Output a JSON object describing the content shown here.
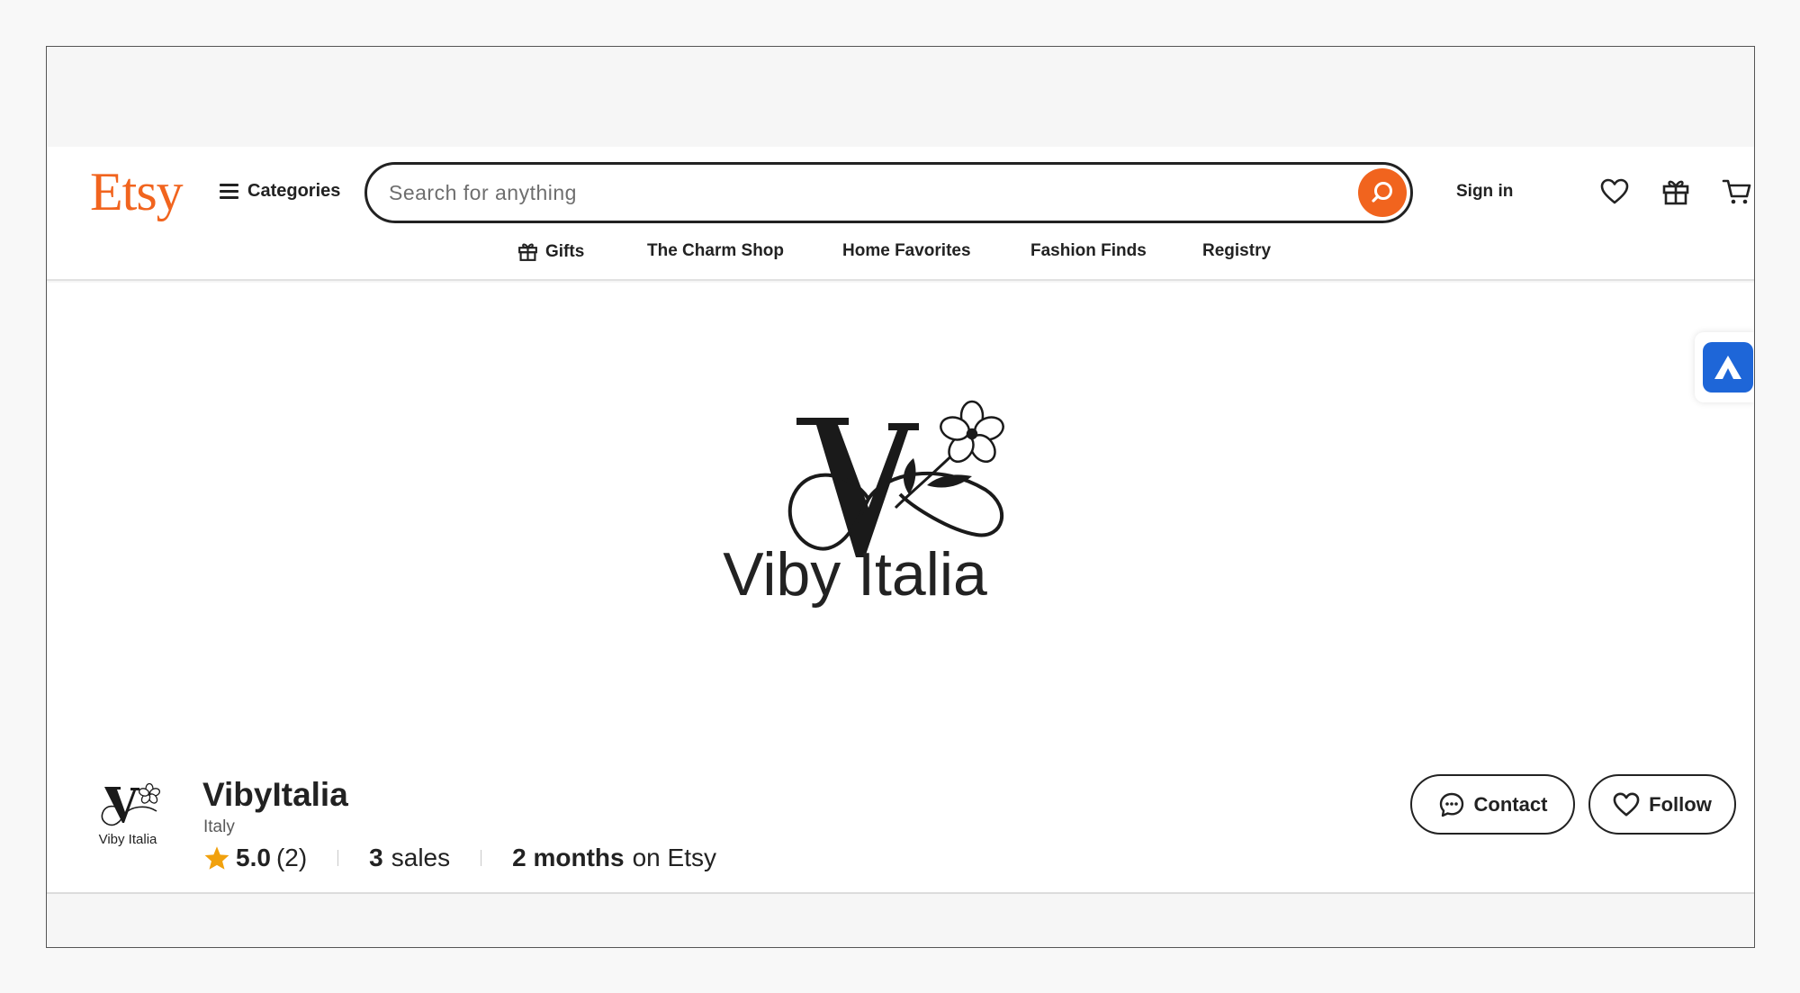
{
  "header": {
    "logo": "Etsy",
    "categories_label": "Categories",
    "search_placeholder": "Search for anything",
    "sign_in": "Sign in"
  },
  "nav": {
    "items": [
      "Gifts",
      "The Charm Shop",
      "Home Favorites",
      "Fashion Finds",
      "Registry"
    ]
  },
  "banner": {
    "logo_text": "Viby Italia"
  },
  "shop": {
    "avatar_text": "Viby Italia",
    "name": "VibyItalia",
    "location": "Italy",
    "rating": "5.0",
    "review_count": "(2)",
    "sales_count": "3",
    "sales_label": "sales",
    "tenure": "2 months",
    "tenure_suffix": "on Etsy"
  },
  "actions": {
    "contact": "Contact",
    "follow": "Follow"
  },
  "colors": {
    "brand": "#f1641e",
    "star": "#f1a10d",
    "side_tab": "#1e66d8"
  }
}
